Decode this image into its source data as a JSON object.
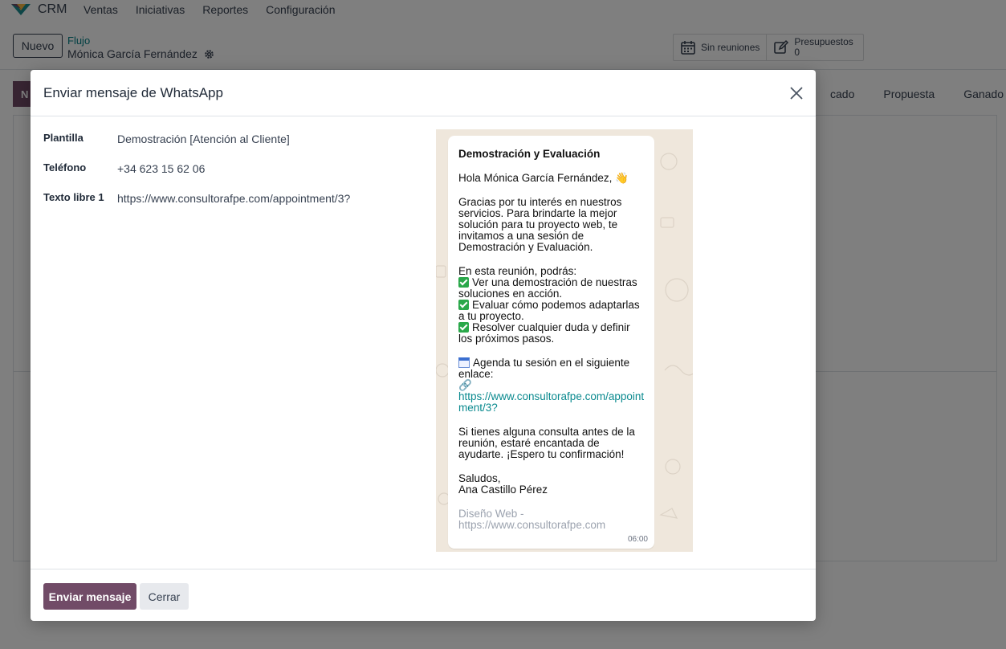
{
  "app": {
    "name": "CRM",
    "menu": [
      "Ventas",
      "Iniciativas",
      "Reportes",
      "Configuración"
    ]
  },
  "control": {
    "new_label": "Nuevo",
    "breadcrumb_parent": "Flujo",
    "breadcrumb_current": "Mónica García Fernández",
    "smart_buttons": {
      "meetings": "Sin reuniones",
      "quotes_label": "Presupuestos",
      "quotes_count": "0"
    }
  },
  "stages": {
    "left_partial": "N",
    "items": [
      "cado",
      "Propuesta",
      "Ganado"
    ]
  },
  "modal": {
    "title": "Enviar mensaje de WhatsApp",
    "fields": [
      {
        "label": "Plantilla",
        "value": "Demostración [Atención al Cliente]"
      },
      {
        "label": "Teléfono",
        "value": "+34 623 15 62 06"
      },
      {
        "label": "Texto libre 1",
        "value": "https://www.consultorafpe.com/appointment/3?"
      }
    ],
    "preview": {
      "title": "Demostración y Evaluación",
      "greeting": "Hola Mónica García Fernández, 👋",
      "intro": "Gracias por tu interés en nuestros servicios. Para brindarte la mejor solución para tu proyecto web, te invitamos a una sesión de Demostración y Evaluación.",
      "list_heading": "En esta reunión, podrás:",
      "bullets": [
        "Ver una demostración de nuestras soluciones en acción.",
        "Evaluar cómo podemos adaptarlas a tu proyecto.",
        "Resolver cualquier duda y definir los próximos pasos."
      ],
      "agenda": "Agenda tu sesión en el siguiente enlace:",
      "link_icon": "🔗",
      "link": "https://www.consultorafpe.com/appointment/3?",
      "closing": "Si tienes alguna consulta antes de la reunión, estaré encantada de ayudarte. ¡Espero tu confirmación!",
      "signoff": "Saludos,",
      "signature": "Ana Castillo Pérez",
      "footer_line1": "Diseño Web -",
      "footer_line2": "https://www.consultorafpe.com",
      "time": "06:00"
    },
    "send_label": "Enviar mensaje",
    "close_label": "Cerrar"
  },
  "colors": {
    "primary": "#714b67",
    "link": "#017e84",
    "whatsapp_bg": "#efe7dc",
    "check": "#2aa84a"
  }
}
